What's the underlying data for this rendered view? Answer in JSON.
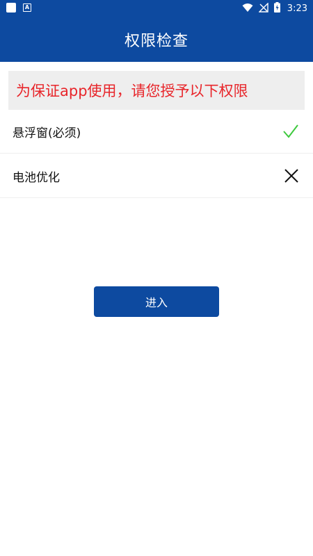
{
  "status_bar": {
    "time": "3:23",
    "left_icons": [
      "square-notification-icon",
      "a-notification-icon"
    ],
    "right_icons": [
      "wifi-icon",
      "no-signal-icon",
      "battery-charging-icon"
    ]
  },
  "app_bar": {
    "title": "权限检查"
  },
  "notice": {
    "text": "为保证app使用，请您授予以下权限"
  },
  "permissions": [
    {
      "label": "悬浮窗(必须)",
      "granted": true,
      "icon": "check-icon"
    },
    {
      "label": "电池优化",
      "granted": false,
      "icon": "cross-icon"
    }
  ],
  "enter_button": {
    "label": "进入"
  },
  "colors": {
    "primary": "#0d4aa0",
    "notice_text": "#e8252a",
    "notice_bg": "#eeeeee",
    "granted": "#3ec93e",
    "denied": "#111111"
  }
}
